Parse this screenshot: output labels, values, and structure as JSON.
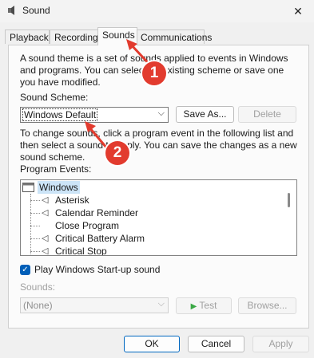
{
  "window": {
    "title": "Sound",
    "close_glyph": "✕"
  },
  "tabs": [
    {
      "label": "Playback"
    },
    {
      "label": "Recording"
    },
    {
      "label": "Sounds"
    },
    {
      "label": "Communications"
    }
  ],
  "sounds_tab": {
    "intro_text": "A sound theme is a set of sounds applied to events in Windows and programs.  You can select an existing scheme or save one you have modified.",
    "scheme_label": "Sound Scheme:",
    "scheme_value": "Windows Default",
    "save_as_label": "Save As...",
    "delete_label": "Delete",
    "instructions": "To change sounds, click a program event in the following list and then select a sound to apply.  You can save the changes as a new sound scheme.",
    "events_label": "Program Events:",
    "events": [
      {
        "label": "Windows",
        "kind": "group"
      },
      {
        "label": "Asterisk",
        "kind": "sound"
      },
      {
        "label": "Calendar Reminder",
        "kind": "sound"
      },
      {
        "label": "Close Program",
        "kind": "none"
      },
      {
        "label": "Critical Battery Alarm",
        "kind": "sound"
      },
      {
        "label": "Critical Stop",
        "kind": "sound"
      }
    ],
    "startup_label": "Play Windows Start-up sound",
    "startup_checked": true,
    "sounds_label": "Sounds:",
    "sounds_value": "(None)",
    "test_label": "Test",
    "browse_label": "Browse..."
  },
  "footer": {
    "ok_label": "OK",
    "cancel_label": "Cancel",
    "apply_label": "Apply"
  },
  "annotations": [
    {
      "number": "1"
    },
    {
      "number": "2"
    }
  ],
  "colors": {
    "accent": "#005fb8",
    "annotation": "#e23b2e"
  }
}
